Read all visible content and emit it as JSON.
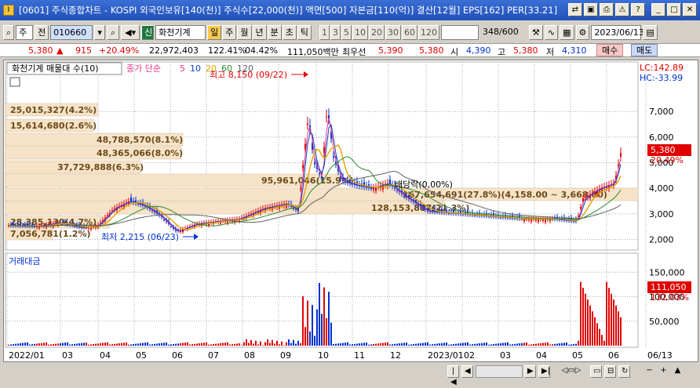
{
  "window": {
    "title": "[0601] 주식종합차트 - KOSPI 외국인보유[140(천)] 주식수[22,000(천)] 액면[500] 자본금[110(억)] 결산[12월] EPS[162] PER[33.21]",
    "icon_label": "I"
  },
  "toolbar": {
    "market": "주",
    "prev_label": "전",
    "code": "010660",
    "name": "화천기계",
    "badge": "신",
    "periods": [
      "일",
      "주",
      "월",
      "년",
      "분",
      "초",
      "틱"
    ],
    "active_period": "일",
    "intervals": [
      "1",
      "3",
      "5",
      "10",
      "20",
      "30",
      "60",
      "120"
    ],
    "count": "348/600",
    "date": "2023/06/13"
  },
  "info": {
    "price": "5,380",
    "change": "915",
    "change_pct": "+20.49%",
    "volume": "22,972,403",
    "vol_ratio": "122.41%",
    "turnover": "04.42%",
    "amount": "111,050백만",
    "best_ask_label": "최우선",
    "best_ask": "5,390",
    "best_bid": "5,380",
    "open_label": "시",
    "open": "4,390",
    "high_label": "고",
    "high": "5,380",
    "low_label": "저",
    "low": "4,310",
    "buy_label": "매수",
    "sell_label": "매도"
  },
  "price_panel": {
    "legend_name": "화천기계 매물대 수(10)",
    "ma_label": "종가 단순",
    "ma_periods": [
      "5",
      "10",
      "20",
      "60",
      "120"
    ],
    "lc": "LC:142.89",
    "hc": "HC:-33.99",
    "current_price": "5,380",
    "current_pct": "20.49%",
    "y_ticks": [
      "7,000",
      "6,000",
      "5,000",
      "4,000",
      "3,000",
      "2,000"
    ],
    "high_note": "최고 8,150 (09/22)",
    "low_note": "최저 2,215 (06/23)",
    "dividend_note": "배당락(0,00%)",
    "volume_profile": [
      {
        "label": "25,015,327(4.2%)"
      },
      {
        "label": "15,614,680(2.6%)"
      },
      {
        "label": "48,788,570(8.1%)"
      },
      {
        "label": "48,365,066(8.0%)"
      },
      {
        "label": "37,729,888(6.3%)"
      },
      {
        "label": "95,961,046(15.9%)"
      },
      {
        "label": "167,654,691(27.8%)(4,158.00 ~ 3,668.00)"
      },
      {
        "label": "128,153,887(21.3%)"
      },
      {
        "label": "28,385,130(4.7%)"
      },
      {
        "label": "7,056,781(1.2%)"
      }
    ]
  },
  "volume_panel": {
    "title": "거래대금",
    "y_ticks": [
      "150,000",
      "100,000",
      "50,000"
    ],
    "current": "111,050",
    "current_pct": "132.03%"
  },
  "x_axis": {
    "labels": [
      "2022/01",
      "03",
      "04",
      "05",
      "06",
      "07",
      "08",
      "09",
      "10",
      "11",
      "12",
      "2023/01",
      "02",
      "03",
      "04",
      "05",
      "06",
      "06/13"
    ]
  },
  "colors": {
    "up": "#e00000",
    "down": "#0030d0",
    "ma5": "#e8348c",
    "ma10": "#1040c0",
    "ma20": "#e8a000",
    "ma60": "#2a8a2a",
    "ma120": "#606060",
    "profile": "#f6e3c8"
  }
}
